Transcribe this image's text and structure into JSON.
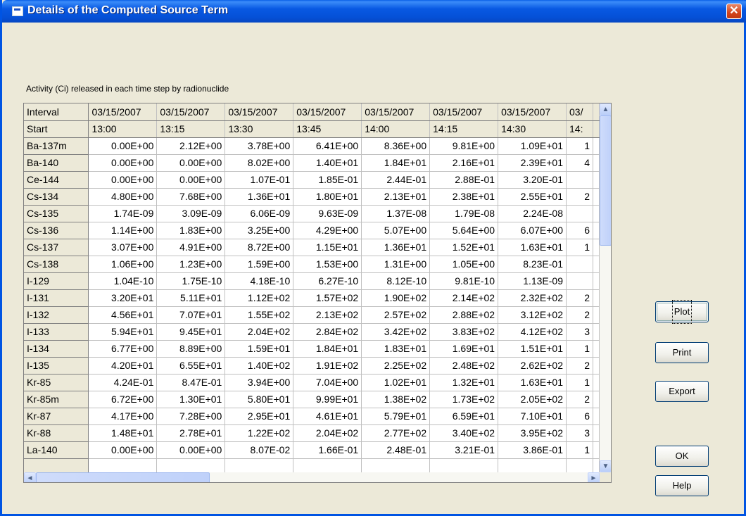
{
  "window": {
    "title": "Details of the Computed Source Term",
    "close_glyph": "✕"
  },
  "caption": "Activity (Ci) released in each time step by radionuclide",
  "table": {
    "header_row1_label": "Interval",
    "header_row2_label": "Start",
    "columns": [
      {
        "date": "03/15/2007",
        "time": "13:00"
      },
      {
        "date": "03/15/2007",
        "time": "13:15"
      },
      {
        "date": "03/15/2007",
        "time": "13:30"
      },
      {
        "date": "03/15/2007",
        "time": "13:45"
      },
      {
        "date": "03/15/2007",
        "time": "14:00"
      },
      {
        "date": "03/15/2007",
        "time": "14:15"
      },
      {
        "date": "03/15/2007",
        "time": "14:30"
      },
      {
        "date": "03/",
        "time": "14:"
      }
    ],
    "rows": [
      {
        "nuclide": "Ba-137m",
        "values": [
          "0.00E+00",
          "2.12E+00",
          "3.78E+00",
          "6.41E+00",
          "8.36E+00",
          "9.81E+00",
          "1.09E+01",
          "1"
        ]
      },
      {
        "nuclide": "Ba-140",
        "values": [
          "0.00E+00",
          "0.00E+00",
          "8.02E+00",
          "1.40E+01",
          "1.84E+01",
          "2.16E+01",
          "2.39E+01",
          "4"
        ]
      },
      {
        "nuclide": "Ce-144",
        "values": [
          "0.00E+00",
          "0.00E+00",
          "1.07E-01",
          "1.85E-01",
          "2.44E-01",
          "2.88E-01",
          "3.20E-01",
          ""
        ]
      },
      {
        "nuclide": "Cs-134",
        "values": [
          "4.80E+00",
          "7.68E+00",
          "1.36E+01",
          "1.80E+01",
          "2.13E+01",
          "2.38E+01",
          "2.55E+01",
          "2"
        ]
      },
      {
        "nuclide": "Cs-135",
        "values": [
          "1.74E-09",
          "3.09E-09",
          "6.06E-09",
          "9.63E-09",
          "1.37E-08",
          "1.79E-08",
          "2.24E-08",
          ""
        ]
      },
      {
        "nuclide": "Cs-136",
        "values": [
          "1.14E+00",
          "1.83E+00",
          "3.25E+00",
          "4.29E+00",
          "5.07E+00",
          "5.64E+00",
          "6.07E+00",
          "6"
        ]
      },
      {
        "nuclide": "Cs-137",
        "values": [
          "3.07E+00",
          "4.91E+00",
          "8.72E+00",
          "1.15E+01",
          "1.36E+01",
          "1.52E+01",
          "1.63E+01",
          "1"
        ]
      },
      {
        "nuclide": "Cs-138",
        "values": [
          "1.06E+00",
          "1.23E+00",
          "1.59E+00",
          "1.53E+00",
          "1.31E+00",
          "1.05E+00",
          "8.23E-01",
          ""
        ]
      },
      {
        "nuclide": "I-129",
        "values": [
          "1.04E-10",
          "1.75E-10",
          "4.18E-10",
          "6.27E-10",
          "8.12E-10",
          "9.81E-10",
          "1.13E-09",
          ""
        ]
      },
      {
        "nuclide": "I-131",
        "values": [
          "3.20E+01",
          "5.11E+01",
          "1.12E+02",
          "1.57E+02",
          "1.90E+02",
          "2.14E+02",
          "2.32E+02",
          "2"
        ]
      },
      {
        "nuclide": "I-132",
        "values": [
          "4.56E+01",
          "7.07E+01",
          "1.55E+02",
          "2.13E+02",
          "2.57E+02",
          "2.88E+02",
          "3.12E+02",
          "2"
        ]
      },
      {
        "nuclide": "I-133",
        "values": [
          "5.94E+01",
          "9.45E+01",
          "2.04E+02",
          "2.84E+02",
          "3.42E+02",
          "3.83E+02",
          "4.12E+02",
          "3"
        ]
      },
      {
        "nuclide": "I-134",
        "values": [
          "6.77E+00",
          "8.89E+00",
          "1.59E+01",
          "1.84E+01",
          "1.83E+01",
          "1.69E+01",
          "1.51E+01",
          "1"
        ]
      },
      {
        "nuclide": "I-135",
        "values": [
          "4.20E+01",
          "6.55E+01",
          "1.40E+02",
          "1.91E+02",
          "2.25E+02",
          "2.48E+02",
          "2.62E+02",
          "2"
        ]
      },
      {
        "nuclide": "Kr-85",
        "values": [
          "4.24E-01",
          "8.47E-01",
          "3.94E+00",
          "7.04E+00",
          "1.02E+01",
          "1.32E+01",
          "1.63E+01",
          "1"
        ]
      },
      {
        "nuclide": "Kr-85m",
        "values": [
          "6.72E+00",
          "1.30E+01",
          "5.80E+01",
          "9.99E+01",
          "1.38E+02",
          "1.73E+02",
          "2.05E+02",
          "2"
        ]
      },
      {
        "nuclide": "Kr-87",
        "values": [
          "4.17E+00",
          "7.28E+00",
          "2.95E+01",
          "4.61E+01",
          "5.79E+01",
          "6.59E+01",
          "7.10E+01",
          "6"
        ]
      },
      {
        "nuclide": "Kr-88",
        "values": [
          "1.48E+01",
          "2.78E+01",
          "1.22E+02",
          "2.04E+02",
          "2.77E+02",
          "3.40E+02",
          "3.95E+02",
          "3"
        ]
      },
      {
        "nuclide": "La-140",
        "values": [
          "0.00E+00",
          "0.00E+00",
          "8.07E-02",
          "1.66E-01",
          "2.48E-01",
          "3.21E-01",
          "3.86E-01",
          "1"
        ]
      },
      {
        "nuclide": "",
        "values": [
          "",
          "",
          "",
          "",
          "",
          "",
          "",
          ""
        ]
      }
    ]
  },
  "scrollbars": {
    "up": "▲",
    "down": "▼",
    "left": "◄",
    "right": "►"
  },
  "buttons": {
    "plot": "Plot",
    "print": "Print",
    "export": "Export",
    "ok": "OK",
    "help": "Help"
  }
}
